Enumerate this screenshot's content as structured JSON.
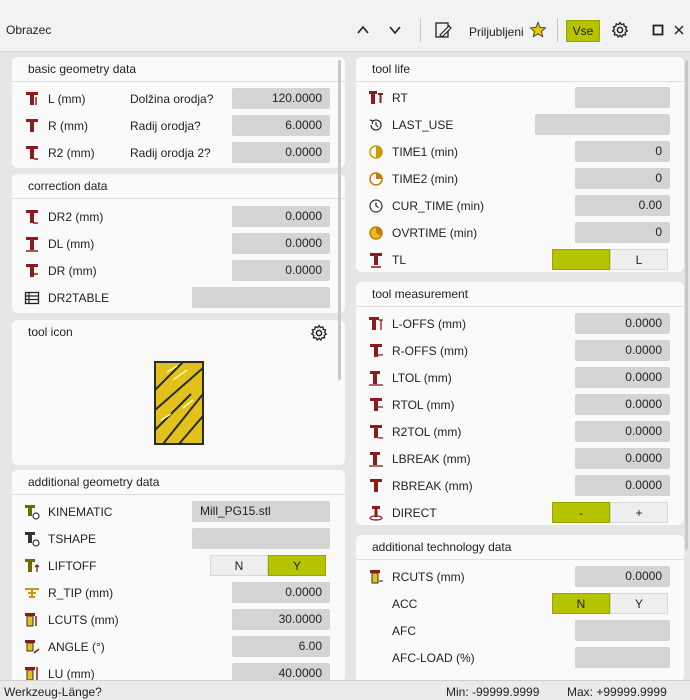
{
  "window": {
    "title": "Obrazec",
    "favorites_label": "Priljubljeni",
    "all_button": "Vse"
  },
  "basic_geometry": {
    "title": "basic geometry data",
    "rows": [
      {
        "label": "L (mm)",
        "desc": "Dolžina orodja?",
        "value": "120.0000"
      },
      {
        "label": "R (mm)",
        "desc": "Radij orodja?",
        "value": "6.0000"
      },
      {
        "label": "R2 (mm)",
        "desc": "Radij orodja 2?",
        "value": "0.0000"
      }
    ]
  },
  "correction": {
    "title": "correction data",
    "rows": [
      {
        "label": "DR2 (mm)",
        "value": "0.0000"
      },
      {
        "label": "DL (mm)",
        "value": "0.0000"
      },
      {
        "label": "DR (mm)",
        "value": "0.0000"
      },
      {
        "label": "DR2TABLE",
        "value": ""
      }
    ]
  },
  "tool_icon": {
    "title": "tool icon"
  },
  "additional_geometry": {
    "title": "additional geometry data",
    "kinematic": {
      "label": "KINEMATIC",
      "value": "Mill_PG15.stl"
    },
    "tshape": {
      "label": "TSHAPE",
      "value": ""
    },
    "liftoff": {
      "label": "LIFTOFF",
      "opt_n": "N",
      "opt_y": "Y"
    },
    "rows": [
      {
        "label": "R_TIP (mm)",
        "value": "0.0000"
      },
      {
        "label": "LCUTS (mm)",
        "value": "30.0000"
      },
      {
        "label": "ANGLE (°)",
        "value": "6.00"
      },
      {
        "label": "LU (mm)",
        "value": "40.0000"
      }
    ]
  },
  "tool_life": {
    "title": "tool life",
    "rows": [
      {
        "label": "RT",
        "value": ""
      },
      {
        "label": "LAST_USE",
        "value": ""
      },
      {
        "label": "TIME1 (min)",
        "value": "0"
      },
      {
        "label": "TIME2 (min)",
        "value": "0"
      },
      {
        "label": "CUR_TIME (min)",
        "value": "0.00"
      },
      {
        "label": "OVRTIME (min)",
        "value": "0"
      }
    ],
    "tl": {
      "label": "TL",
      "opt_l": "L"
    }
  },
  "tool_measurement": {
    "title": "tool measurement",
    "rows": [
      {
        "label": "L-OFFS (mm)",
        "value": "0.0000"
      },
      {
        "label": "R-OFFS (mm)",
        "value": "0.0000"
      },
      {
        "label": "LTOL (mm)",
        "value": "0.0000"
      },
      {
        "label": "RTOL (mm)",
        "value": "0.0000"
      },
      {
        "label": "R2TOL (mm)",
        "value": "0.0000"
      },
      {
        "label": "LBREAK (mm)",
        "value": "0.0000"
      },
      {
        "label": "RBREAK (mm)",
        "value": "0.0000"
      }
    ],
    "direct": {
      "label": "DIRECT",
      "opt_minus": "-",
      "opt_plus": "+"
    }
  },
  "additional_tech": {
    "title": "additional technology data",
    "rcuts": {
      "label": "RCUTS (mm)",
      "value": "0.0000"
    },
    "acc": {
      "label": "ACC",
      "opt_n": "N",
      "opt_y": "Y"
    },
    "afc": {
      "label": "AFC",
      "value": ""
    },
    "afc_load": {
      "label": "AFC-LOAD (%)",
      "value": ""
    }
  },
  "status": {
    "prompt": "Werkzeug-Länge?",
    "min": "Min: -99999.9999",
    "max": "Max: +99999.9999"
  },
  "colors": {
    "accent": "#b6c400",
    "field": "#d4d4d4",
    "tool_red": "#8a1c1c",
    "tool_yellow": "#e2c21a"
  }
}
